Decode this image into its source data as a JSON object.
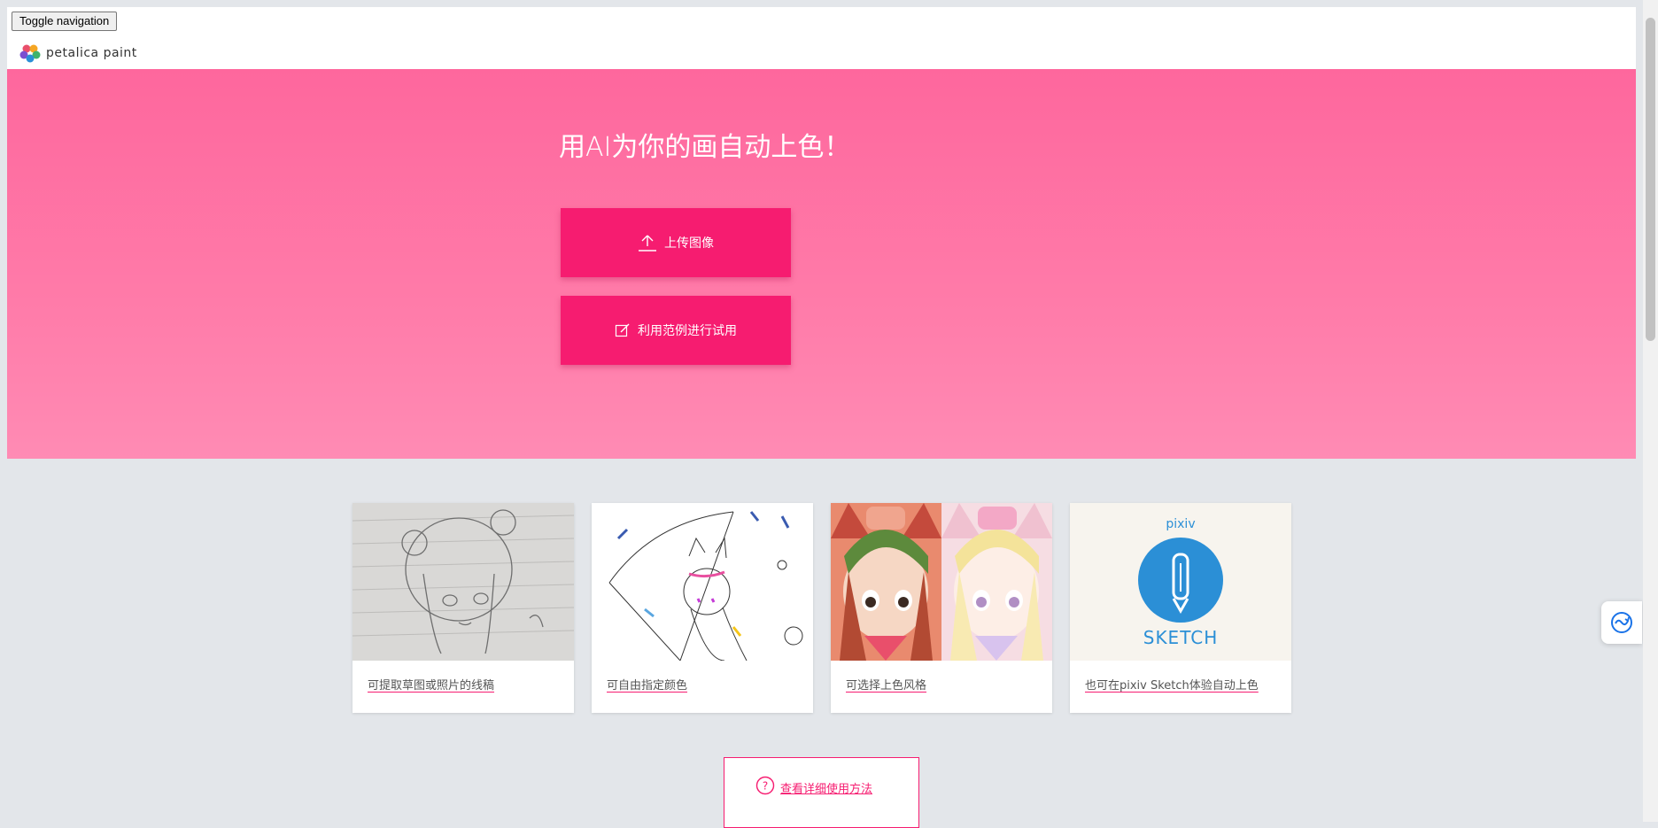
{
  "nav": {
    "toggle_label": "Toggle navigation",
    "brand": "petalica paint"
  },
  "hero": {
    "title": "用AI为你的画自动上色！",
    "upload_label": "上传图像",
    "sample_label": "利用范例进行试用"
  },
  "cards": [
    {
      "label": "可提取草图或照片的线稿"
    },
    {
      "label": "可自由指定颜色"
    },
    {
      "label": "可选择上色风格"
    },
    {
      "label": "也可在pixiv Sketch体验自动上色",
      "logo_text": "pixiv",
      "logo_sub": "SKETCH"
    }
  ],
  "help": {
    "label": "查看详细使用方法"
  },
  "colors": {
    "accent": "#f61c70",
    "hero_top": "#fe679d",
    "hero_bottom": "#ff8bb4",
    "pixiv_blue": "#2b8fd6"
  },
  "icons": [
    "logo-petals-icon",
    "upload-icon",
    "edit-icon",
    "question-circle-icon",
    "refresh-widget-icon"
  ]
}
